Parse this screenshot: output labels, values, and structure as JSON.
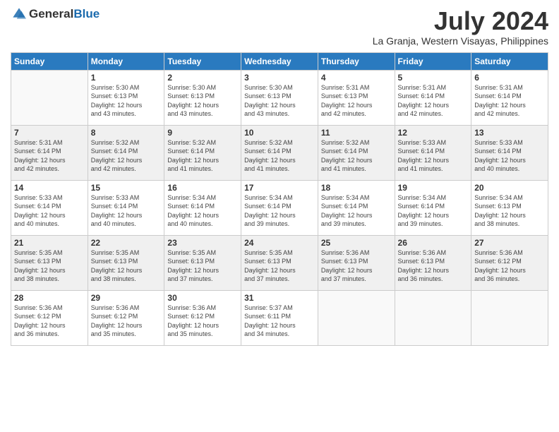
{
  "header": {
    "logo_line1": "General",
    "logo_line2": "Blue",
    "month_title": "July 2024",
    "location": "La Granja, Western Visayas, Philippines"
  },
  "days_of_week": [
    "Sunday",
    "Monday",
    "Tuesday",
    "Wednesday",
    "Thursday",
    "Friday",
    "Saturday"
  ],
  "weeks": [
    [
      {
        "day": "",
        "info": ""
      },
      {
        "day": "1",
        "info": "Sunrise: 5:30 AM\nSunset: 6:13 PM\nDaylight: 12 hours\nand 43 minutes."
      },
      {
        "day": "2",
        "info": "Sunrise: 5:30 AM\nSunset: 6:13 PM\nDaylight: 12 hours\nand 43 minutes."
      },
      {
        "day": "3",
        "info": "Sunrise: 5:30 AM\nSunset: 6:13 PM\nDaylight: 12 hours\nand 43 minutes."
      },
      {
        "day": "4",
        "info": "Sunrise: 5:31 AM\nSunset: 6:13 PM\nDaylight: 12 hours\nand 42 minutes."
      },
      {
        "day": "5",
        "info": "Sunrise: 5:31 AM\nSunset: 6:14 PM\nDaylight: 12 hours\nand 42 minutes."
      },
      {
        "day": "6",
        "info": "Sunrise: 5:31 AM\nSunset: 6:14 PM\nDaylight: 12 hours\nand 42 minutes."
      }
    ],
    [
      {
        "day": "7",
        "info": ""
      },
      {
        "day": "8",
        "info": "Sunrise: 5:32 AM\nSunset: 6:14 PM\nDaylight: 12 hours\nand 42 minutes."
      },
      {
        "day": "9",
        "info": "Sunrise: 5:32 AM\nSunset: 6:14 PM\nDaylight: 12 hours\nand 41 minutes."
      },
      {
        "day": "10",
        "info": "Sunrise: 5:32 AM\nSunset: 6:14 PM\nDaylight: 12 hours\nand 41 minutes."
      },
      {
        "day": "11",
        "info": "Sunrise: 5:32 AM\nSunset: 6:14 PM\nDaylight: 12 hours\nand 41 minutes."
      },
      {
        "day": "12",
        "info": "Sunrise: 5:33 AM\nSunset: 6:14 PM\nDaylight: 12 hours\nand 41 minutes."
      },
      {
        "day": "13",
        "info": "Sunrise: 5:33 AM\nSunset: 6:14 PM\nDaylight: 12 hours\nand 40 minutes."
      }
    ],
    [
      {
        "day": "14",
        "info": ""
      },
      {
        "day": "15",
        "info": "Sunrise: 5:33 AM\nSunset: 6:14 PM\nDaylight: 12 hours\nand 40 minutes."
      },
      {
        "day": "16",
        "info": "Sunrise: 5:34 AM\nSunset: 6:14 PM\nDaylight: 12 hours\nand 40 minutes."
      },
      {
        "day": "17",
        "info": "Sunrise: 5:34 AM\nSunset: 6:14 PM\nDaylight: 12 hours\nand 39 minutes."
      },
      {
        "day": "18",
        "info": "Sunrise: 5:34 AM\nSunset: 6:14 PM\nDaylight: 12 hours\nand 39 minutes."
      },
      {
        "day": "19",
        "info": "Sunrise: 5:34 AM\nSunset: 6:14 PM\nDaylight: 12 hours\nand 39 minutes."
      },
      {
        "day": "20",
        "info": "Sunrise: 5:34 AM\nSunset: 6:13 PM\nDaylight: 12 hours\nand 38 minutes."
      }
    ],
    [
      {
        "day": "21",
        "info": ""
      },
      {
        "day": "22",
        "info": "Sunrise: 5:35 AM\nSunset: 6:13 PM\nDaylight: 12 hours\nand 38 minutes."
      },
      {
        "day": "23",
        "info": "Sunrise: 5:35 AM\nSunset: 6:13 PM\nDaylight: 12 hours\nand 37 minutes."
      },
      {
        "day": "24",
        "info": "Sunrise: 5:35 AM\nSunset: 6:13 PM\nDaylight: 12 hours\nand 37 minutes."
      },
      {
        "day": "25",
        "info": "Sunrise: 5:36 AM\nSunset: 6:13 PM\nDaylight: 12 hours\nand 37 minutes."
      },
      {
        "day": "26",
        "info": "Sunrise: 5:36 AM\nSunset: 6:13 PM\nDaylight: 12 hours\nand 36 minutes."
      },
      {
        "day": "27",
        "info": "Sunrise: 5:36 AM\nSunset: 6:12 PM\nDaylight: 12 hours\nand 36 minutes."
      }
    ],
    [
      {
        "day": "28",
        "info": "Sunrise: 5:36 AM\nSunset: 6:12 PM\nDaylight: 12 hours\nand 36 minutes."
      },
      {
        "day": "29",
        "info": "Sunrise: 5:36 AM\nSunset: 6:12 PM\nDaylight: 12 hours\nand 35 minutes."
      },
      {
        "day": "30",
        "info": "Sunrise: 5:36 AM\nSunset: 6:12 PM\nDaylight: 12 hours\nand 35 minutes."
      },
      {
        "day": "31",
        "info": "Sunrise: 5:37 AM\nSunset: 6:11 PM\nDaylight: 12 hours\nand 34 minutes."
      },
      {
        "day": "",
        "info": ""
      },
      {
        "day": "",
        "info": ""
      },
      {
        "day": "",
        "info": ""
      }
    ]
  ],
  "week7_sunday_info": "Sunrise: 5:31 AM\nSunset: 6:14 PM\nDaylight: 12 hours\nand 42 minutes.",
  "week14_sunday_info": "Sunrise: 5:33 AM\nSunset: 6:14 PM\nDaylight: 12 hours\nand 40 minutes.",
  "week21_sunday_info": "Sunrise: 5:35 AM\nSunset: 6:13 PM\nDaylight: 12 hours\nand 38 minutes."
}
